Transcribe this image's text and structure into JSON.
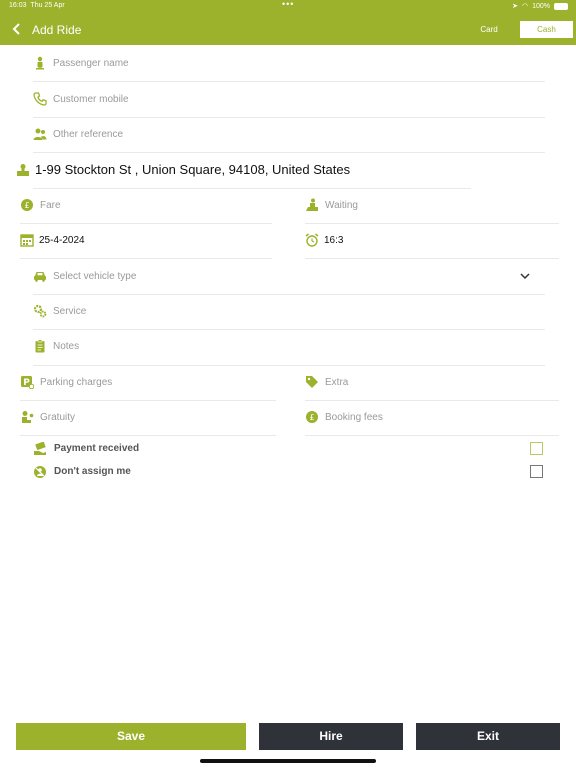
{
  "status": {
    "time": "16:03",
    "date": "Thu 25 Apr",
    "dots": "•••",
    "battery": "100%"
  },
  "nav": {
    "title": "Add Ride",
    "card_label": "Card",
    "cash_label": "Cash"
  },
  "form": {
    "passenger_name": "Passenger name",
    "customer_mobile": "Customer mobile",
    "other_reference": "Other reference",
    "address": "1-99 Stockton St , Union Square, 94108, United States",
    "fare": "Fare",
    "waiting": "Waiting",
    "date": "25-4-2024",
    "time": "16:3",
    "vehicle_type": "Select vehicle type",
    "service": "Service",
    "notes": "Notes",
    "parking_charges": "Parking charges",
    "extra": "Extra",
    "gratuity": "Gratuity",
    "booking_fees": "Booking fees",
    "payment_received": "Payment received",
    "dont_assign_me": "Don't assign me"
  },
  "buttons": {
    "save": "Save",
    "hire": "Hire",
    "exit": "Exit"
  },
  "colors": {
    "accent": "#9cb22c",
    "dark_button": "#303239"
  }
}
